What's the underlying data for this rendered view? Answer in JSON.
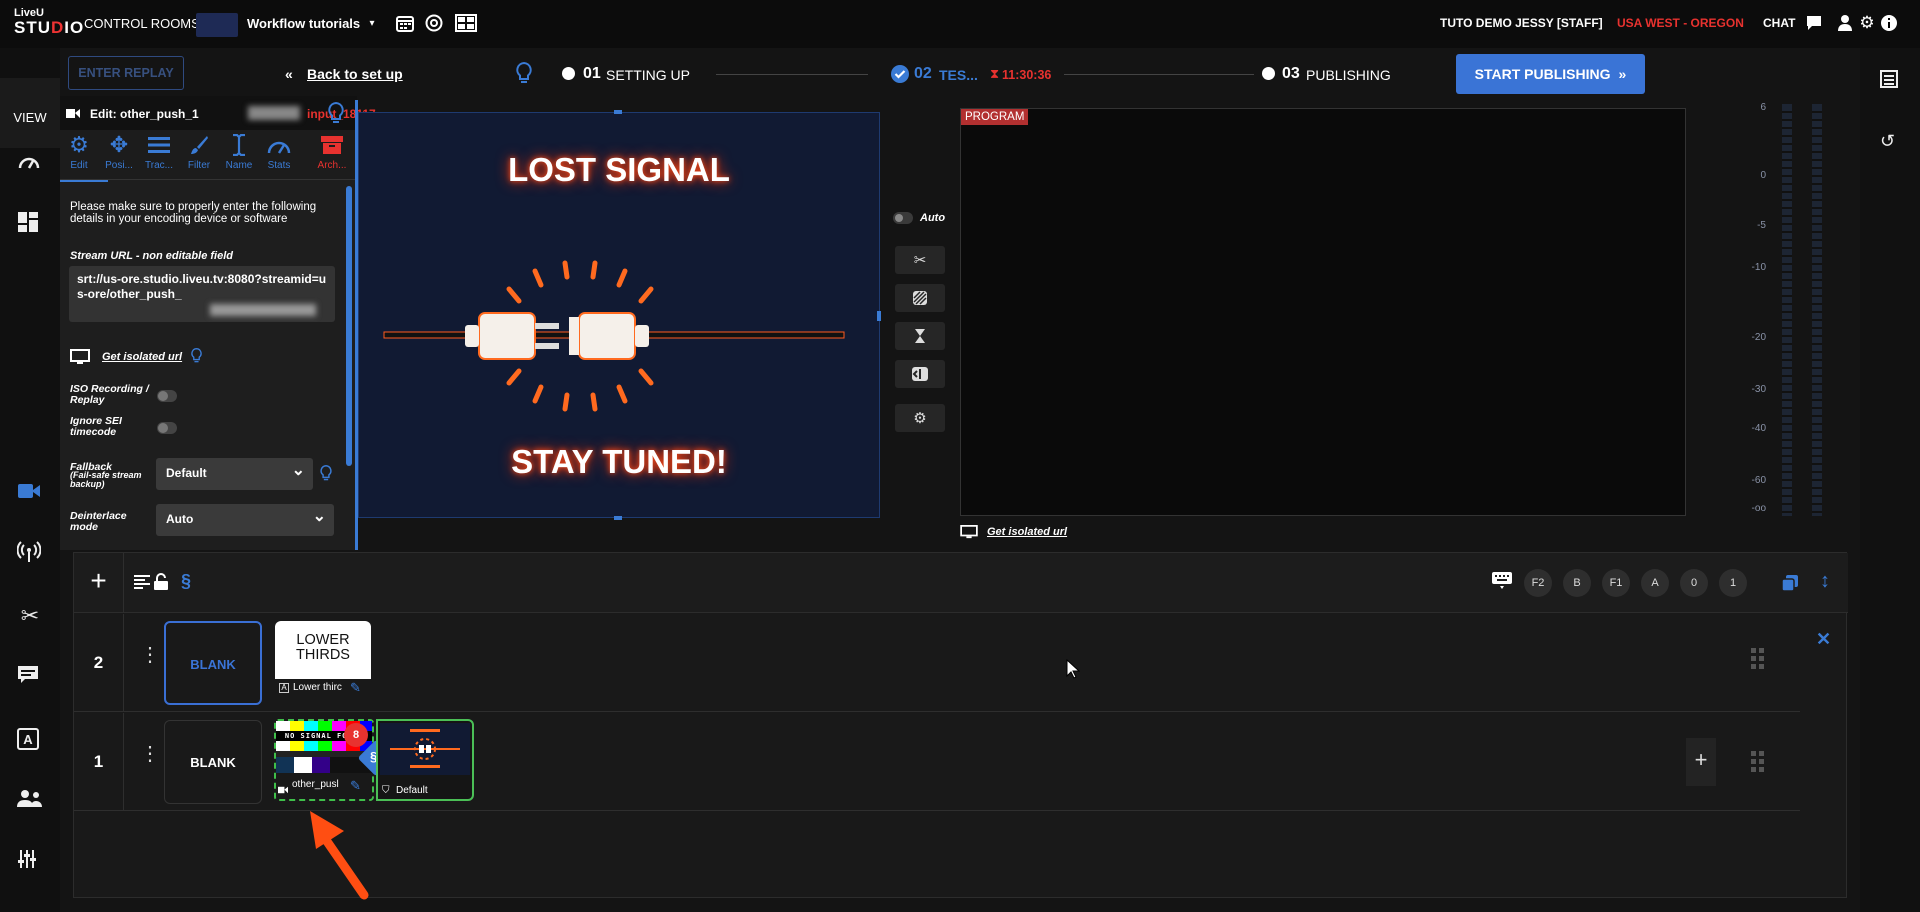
{
  "header": {
    "logo_top": "LiveU",
    "logo_bottom_a": "STU",
    "logo_bottom_b": "D",
    "logo_bottom_c": "IO",
    "control_rooms": "CONTROL ROOMS",
    "workflow": "Workflow tutorials",
    "user": "TUTO DEMO JESSY [STAFF]",
    "region": "USA WEST - OREGON",
    "chat": "CHAT"
  },
  "steps": {
    "enter_replay": "ENTER REPLAY",
    "back": "Back to set up",
    "s1_num": "01",
    "s1_label": "SETTING UP",
    "s2_num": "02",
    "s2_label": "TES...",
    "timer": "11:30:36",
    "s3_num": "03",
    "s3_label": "PUBLISHING",
    "start": "START PUBLISHING"
  },
  "nav": {
    "view": "VIEW"
  },
  "edit_panel": {
    "title": "Edit: other_push_1",
    "input_id": "input_18117",
    "tools": [
      "Edit",
      "Posi...",
      "Trac...",
      "Filter",
      "Name",
      "Stats",
      "Arch..."
    ],
    "notice": "Please make sure to properly enter the following details in your encoding device or software",
    "stream_label": "Stream URL - non editable field",
    "stream_url": "srt://us-ore.studio.liveu.tv:8080?streamid=us-ore/other_push_",
    "isolated_link": "Get isolated url",
    "iso_label": "ISO Recording / Replay",
    "sei_label": "Ignore SEI timecode",
    "fallback_label": "Fallback",
    "fallback_sub": "(Fail-safe stream backup)",
    "fallback_value": "Default",
    "deinterlace_label": "Deinterlace mode",
    "deinterlace_value": "Auto"
  },
  "preview": {
    "line1": "LOST SIGNAL",
    "line2": "STAY TUNED!"
  },
  "program": {
    "badge": "PROGRAM",
    "isolated_link": "Get isolated url",
    "auto": "Auto"
  },
  "vu_labels": [
    "6",
    "0",
    "-5",
    "-10",
    "-20",
    "-30",
    "-40",
    "-60",
    "-oo"
  ],
  "lanes": {
    "keys": [
      "F2",
      "B",
      "F1",
      "A",
      "0",
      "1"
    ],
    "rows": [
      {
        "num": "2",
        "blank": "BLANK",
        "source_title": "LOWER THIRDS",
        "source_caption": "Lower thirc"
      },
      {
        "num": "1",
        "blank": "BLANK",
        "source_caption": "other_pusl",
        "source_badge": "8",
        "fallback_caption": "Default",
        "thumb_text": "NO SIGNAL FOUND"
      }
    ]
  }
}
